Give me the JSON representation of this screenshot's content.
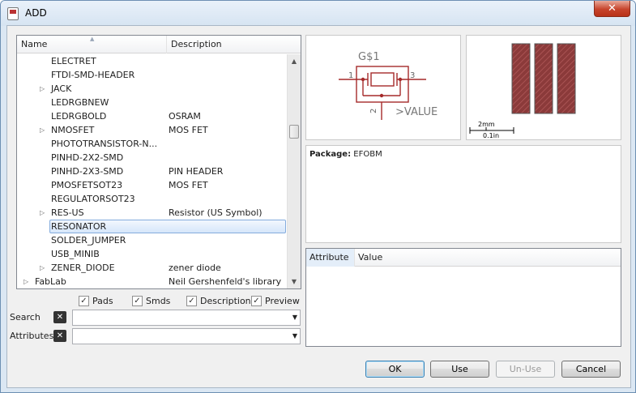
{
  "window": {
    "title": "ADD",
    "close_glyph": "✕"
  },
  "tree": {
    "columns": {
      "name": "Name",
      "description": "Description"
    },
    "rows": [
      {
        "name": "ELECTRET",
        "desc": "",
        "indent": 2,
        "expandable": false,
        "selected": false
      },
      {
        "name": "FTDI-SMD-HEADER",
        "desc": "",
        "indent": 2,
        "expandable": false,
        "selected": false
      },
      {
        "name": "JACK",
        "desc": "",
        "indent": 2,
        "expandable": true,
        "selected": false
      },
      {
        "name": "LEDRGBNEW",
        "desc": "",
        "indent": 2,
        "expandable": false,
        "selected": false
      },
      {
        "name": "LEDRGBOLD",
        "desc": "OSRAM",
        "indent": 2,
        "expandable": false,
        "selected": false
      },
      {
        "name": "NMOSFET",
        "desc": "MOS FET",
        "indent": 2,
        "expandable": true,
        "selected": false
      },
      {
        "name": "PHOTOTRANSISTOR-N...",
        "desc": "",
        "indent": 2,
        "expandable": false,
        "selected": false
      },
      {
        "name": "PINHD-2X2-SMD",
        "desc": "",
        "indent": 2,
        "expandable": false,
        "selected": false
      },
      {
        "name": "PINHD-2X3-SMD",
        "desc": "PIN HEADER",
        "indent": 2,
        "expandable": false,
        "selected": false
      },
      {
        "name": "PMOSFETSOT23",
        "desc": "MOS FET",
        "indent": 2,
        "expandable": false,
        "selected": false
      },
      {
        "name": "REGULATORSOT23",
        "desc": "",
        "indent": 2,
        "expandable": false,
        "selected": false
      },
      {
        "name": "RES-US",
        "desc": "Resistor (US Symbol)",
        "indent": 2,
        "expandable": true,
        "selected": false
      },
      {
        "name": "RESONATOR",
        "desc": "",
        "indent": 2,
        "expandable": false,
        "selected": true
      },
      {
        "name": "SOLDER_JUMPER",
        "desc": "",
        "indent": 2,
        "expandable": false,
        "selected": false
      },
      {
        "name": "USB_MINIB",
        "desc": "",
        "indent": 2,
        "expandable": false,
        "selected": false
      },
      {
        "name": "ZENER_DIODE",
        "desc": "zener diode",
        "indent": 2,
        "expandable": true,
        "selected": false
      },
      {
        "name": "FabLab",
        "desc": "Neil Gershenfeld's library",
        "indent": 0,
        "expandable": true,
        "selected": false
      }
    ]
  },
  "filters": {
    "pads": {
      "label": "Pads",
      "checked": true
    },
    "smds": {
      "label": "Smds",
      "checked": true
    },
    "description": {
      "label": "Description",
      "checked": true
    },
    "preview": {
      "label": "Preview",
      "checked": true
    }
  },
  "search": {
    "label": "Search",
    "value": ""
  },
  "attributes_filter": {
    "label": "Attributes",
    "value": ""
  },
  "symbol_preview": {
    "name_label": "G$1",
    "pin1": "1",
    "pin2": "2",
    "pin3": "3",
    "value_label": ">VALUE"
  },
  "package_preview": {
    "scale_mm": "2mm",
    "scale_in": "0.1in"
  },
  "package_info": {
    "label": "Package:",
    "value": "EFOBM"
  },
  "attributes_table": {
    "col_attribute": "Attribute",
    "col_value": "Value"
  },
  "buttons": {
    "ok": "OK",
    "use": "Use",
    "unuse": "Un-Use",
    "cancel": "Cancel"
  },
  "colors": {
    "schematic": "#a52a2a",
    "pad_fill": "#8b3a3a",
    "selection": "#d6e6fa"
  }
}
